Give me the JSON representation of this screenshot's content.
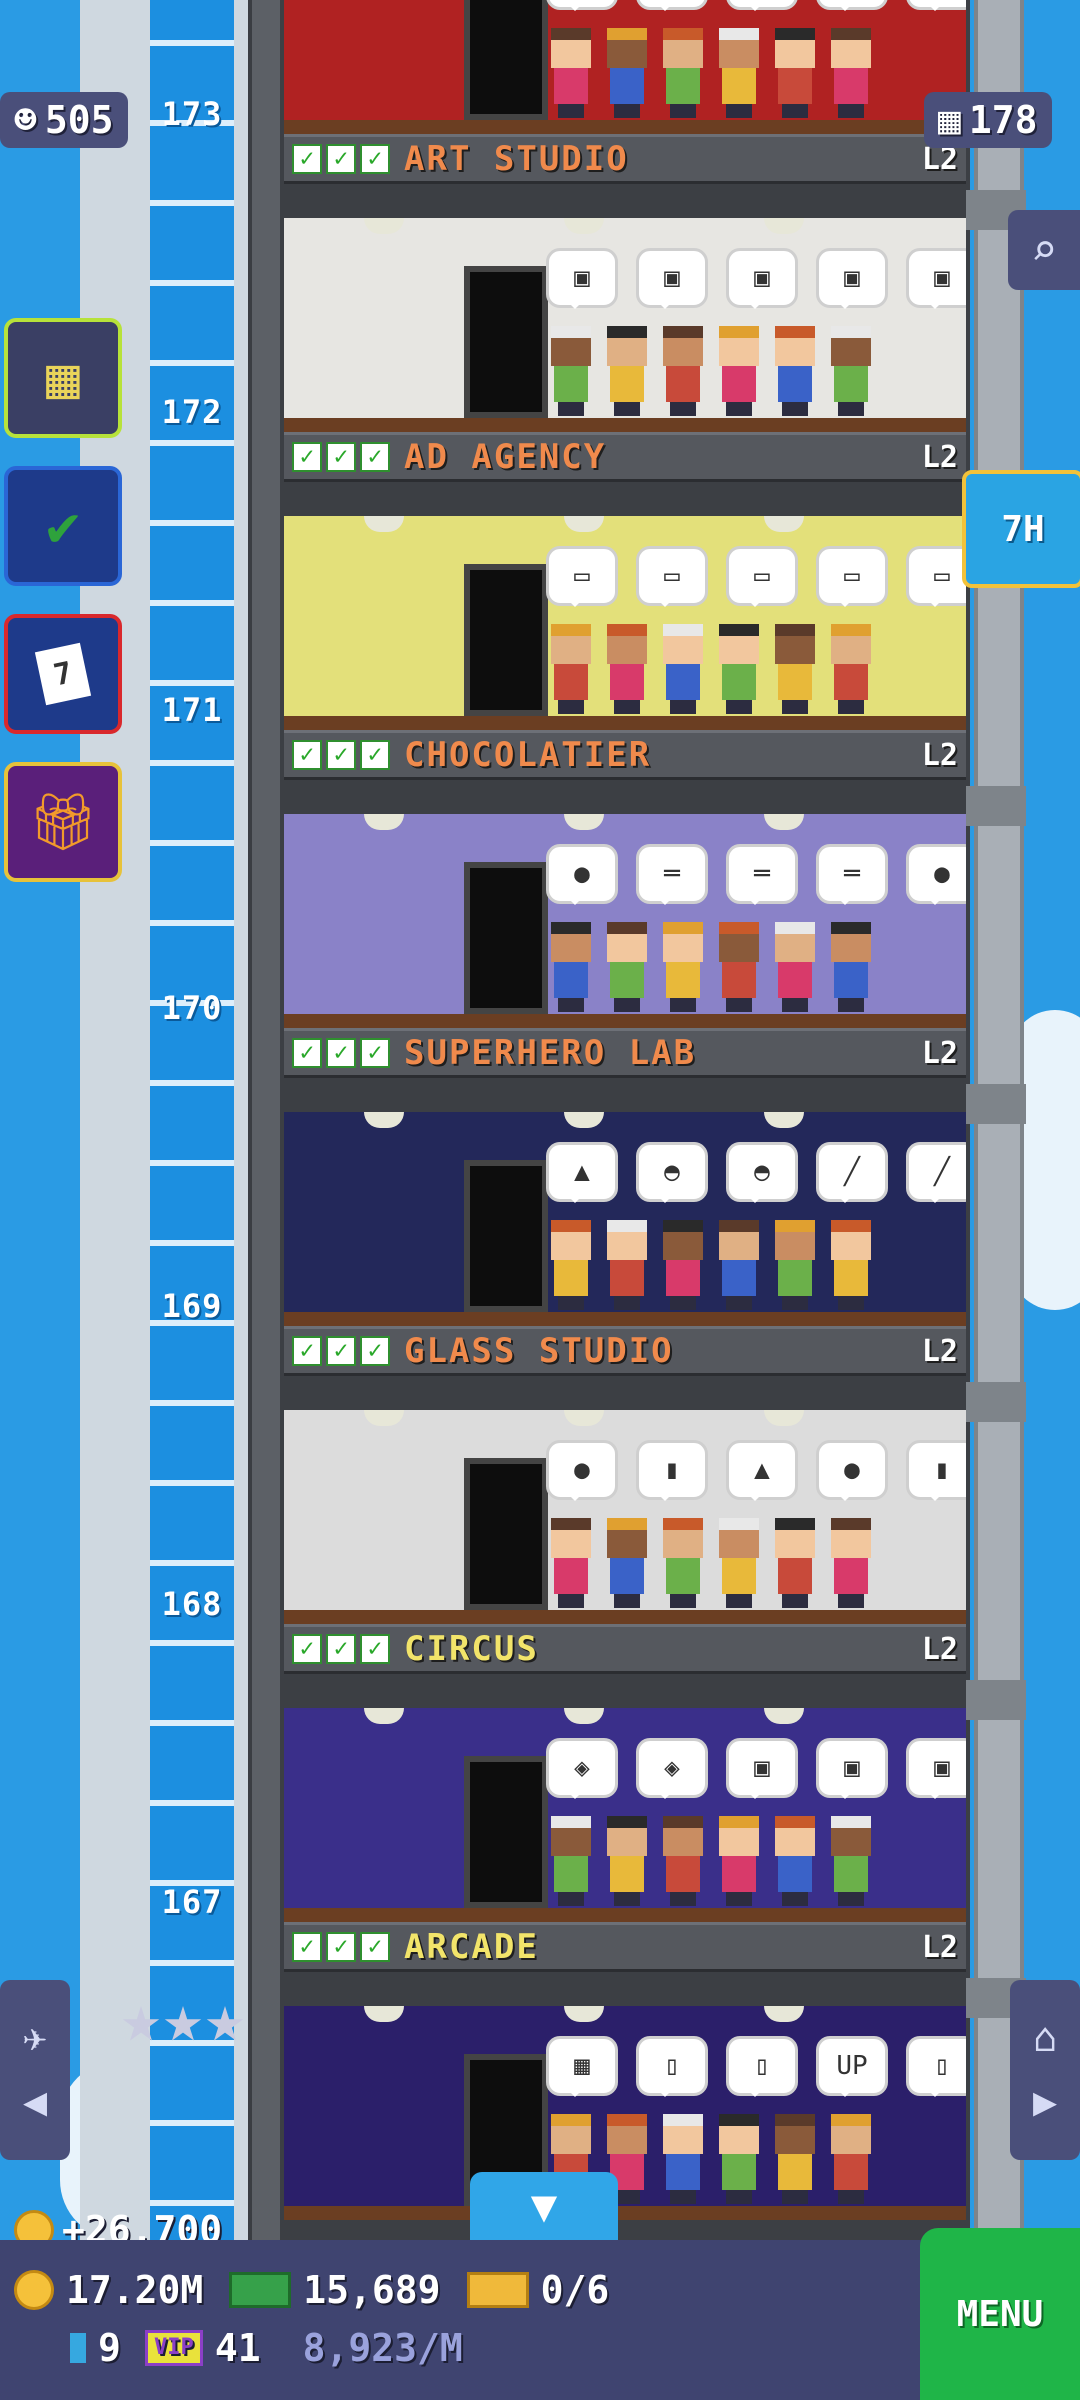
{
  "colors": {
    "sky": "#2a9be4",
    "shaft": "#1c8fe0",
    "label_bar": "#55585e",
    "hud": "#3f4470",
    "menu": "#1fb548",
    "stage_label_orange": "#f08a4c",
    "stage_label_yellow": "#f2e46a"
  },
  "hud_top": {
    "population": "505",
    "floors": "178"
  },
  "shaft": {
    "floor_numbers": [
      "173",
      "172",
      "171",
      "170",
      "169",
      "168",
      "167"
    ]
  },
  "side_buttons": [
    {
      "icon": "building-icon"
    },
    {
      "icon": "checklist-icon"
    },
    {
      "icon": "calendar-icon",
      "text": "7"
    },
    {
      "icon": "gift-icon"
    }
  ],
  "timer_badge": "7H",
  "floors": [
    {
      "name": "ART STUDIO",
      "level": "L2",
      "name_color": "#f08a4c",
      "wall": "#b02222",
      "bubbles": [
        "👁",
        "◆",
        "◆",
        "◆",
        "◆"
      ]
    },
    {
      "name": "AD AGENCY",
      "level": "L2",
      "name_color": "#f08a4c",
      "wall": "#e7e6e2",
      "bubbles": [
        "▣",
        "▣",
        "▣",
        "▣",
        "▣"
      ]
    },
    {
      "name": "CHOCOLATIER",
      "level": "L2",
      "name_color": "#f08a4c",
      "wall": "#e3e07a",
      "bubbles": [
        "▭",
        "▭",
        "▭",
        "▭",
        "▭"
      ]
    },
    {
      "name": "SUPERHERO LAB",
      "level": "L2",
      "name_color": "#f08a4c",
      "wall": "#8a82c8",
      "bubbles": [
        "●",
        "═",
        "═",
        "═",
        "●"
      ]
    },
    {
      "name": "GLASS STUDIO",
      "level": "L2",
      "name_color": "#f08a4c",
      "wall": "#23285a",
      "bubbles": [
        "▲",
        "◓",
        "◓",
        "╱",
        "╱"
      ]
    },
    {
      "name": "CIRCUS",
      "level": "L2",
      "name_color": "#f2e46a",
      "wall": "#dcdcdc",
      "bubbles": [
        "●",
        "▮",
        "▲",
        "●",
        "▮"
      ]
    },
    {
      "name": "ARCADE",
      "level": "L2",
      "name_color": "#f2e46a",
      "wall": "#3a2f8a",
      "bubbles": [
        "◈",
        "◈",
        "▣",
        "▣",
        "▣"
      ]
    },
    {
      "name": "",
      "level": "",
      "name_color": "#f2e46a",
      "wall": "#2b1f6a",
      "bubbles": [
        "▦",
        "▯",
        "▯",
        "UP",
        "▯"
      ]
    }
  ],
  "bottom_hud": {
    "coin_gain": "+26,700",
    "coins": "17.20M",
    "bux": "15,689",
    "tickets": "0/6",
    "gems": "9",
    "vip": "41",
    "vip_label": "VIP",
    "income_rate": "8,923/M",
    "menu_label": "MENU"
  },
  "nav": {
    "left": "elevator-nav",
    "right": "home-nav"
  }
}
